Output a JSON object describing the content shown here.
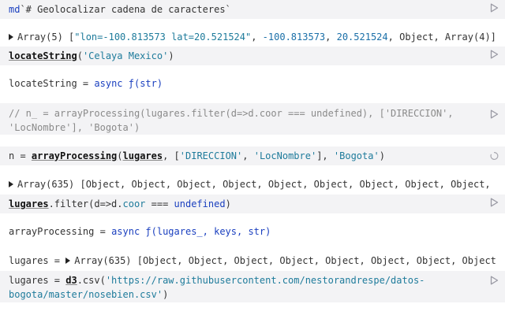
{
  "cells": [
    {
      "id": "md-cell",
      "code": {
        "tag": "md",
        "text": "`# Geolocalizar cadena de caracteres`"
      }
    },
    {
      "id": "array-output",
      "caret": "▸",
      "prefix": "Array(5) [",
      "items": [
        {
          "t": "str",
          "v": "\"lon=-100.813573 lat=20.521524\""
        },
        {
          "t": "sep",
          "v": ", "
        },
        {
          "t": "num",
          "v": "-100.813573"
        },
        {
          "t": "sep",
          "v": ", "
        },
        {
          "t": "num",
          "v": "20.521524"
        },
        {
          "t": "sep",
          "v": ", Object, Array(4)]"
        }
      ]
    },
    {
      "id": "locate-call",
      "fn": "locateString",
      "open": "(",
      "arg": "'Celaya  Mexico'",
      "close": ")"
    },
    {
      "id": "locate-def-output",
      "name": "locateString",
      "eq": " = ",
      "async": "async",
      "sig": " ƒ(str)"
    },
    {
      "id": "comment-cell",
      "text": "// n_ = arrayProcessing(lugares.filter(d=>d.coor === undefined), ['DIRECCION', 'LocNombre'], 'Bogota')"
    },
    {
      "id": "n-cell",
      "lhs": "n = ",
      "fn": "arrayProcessing",
      "open": "(",
      "arg1": "lugares",
      "mid": ", [",
      "s1": "'DIRECCION'",
      "comma": ", ",
      "s2": "'LocNombre'",
      "mid2": "], ",
      "s3": "'Bogota'",
      "close": ")"
    },
    {
      "id": "filter-output",
      "caret": "▸",
      "text": "Array(635) [Object, Object, Object, Object, Object, Object, Object, Object, Object, Object, Obj"
    },
    {
      "id": "filter-cell",
      "var": "lugares",
      "method": ".filter(",
      "param": "d=>d.",
      "prop": "coor",
      "op": " === ",
      "undef": "undefined",
      "close": ")"
    },
    {
      "id": "processing-output",
      "name": "arrayProcessing",
      "eq": " = ",
      "async": "async",
      "sig": " ƒ(lugares_, keys, str)"
    },
    {
      "id": "lugares-output",
      "name": "lugares",
      "eq": " = ",
      "caret": "▸",
      "text": "Array(635) [Object, Object, Object, Object, Object, Object, Object, Object, Object, O"
    },
    {
      "id": "lugares-cell",
      "lhs": "lugares = ",
      "lib": "d3",
      "method": ".csv(",
      "url": "'https://raw.githubusercontent.com/nestorandrespe/datos-bogota/master/nosebien.csv'",
      "close": ")"
    }
  ],
  "colors": {
    "cell_bg": "#f3f3f5",
    "string": "#1e7b9b",
    "keyword": "#1a3fbf",
    "comment": "#8a8a8a"
  },
  "icons": {
    "run": "play-icon",
    "pending": "spinner-icon"
  }
}
